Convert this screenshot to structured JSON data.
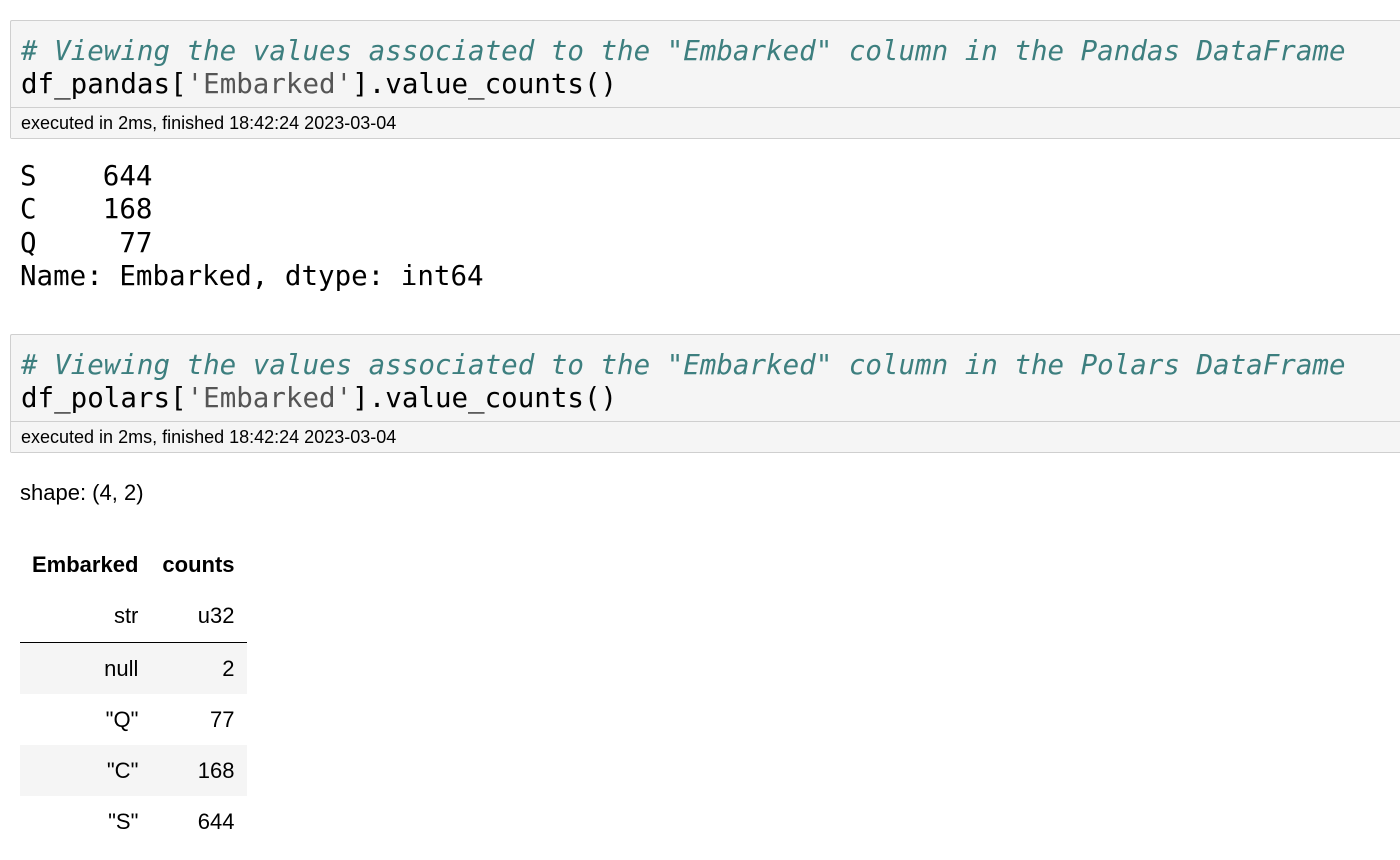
{
  "cell1": {
    "comment": "# Viewing the values associated to the \"Embarked\" column in the Pandas DataFrame",
    "code_prefix": "df_pandas[",
    "code_string": "'Embarked'",
    "code_suffix": "].value_counts()",
    "exec_info": "executed in 2ms, finished 18:42:24 2023-03-04",
    "output": "S    644\nC    168\nQ     77\nName: Embarked, dtype: int64"
  },
  "cell2": {
    "comment": "# Viewing the values associated to the \"Embarked\" column in the Polars DataFrame",
    "code_prefix": "df_polars[",
    "code_string": "'Embarked'",
    "code_suffix": "].value_counts()",
    "exec_info": "executed in 2ms, finished 18:42:24 2023-03-04",
    "shape": "shape: (4, 2)",
    "table": {
      "columns": [
        "Embarked",
        "counts"
      ],
      "dtypes": [
        "str",
        "u32"
      ],
      "rows": [
        [
          "null",
          "2"
        ],
        [
          "\"Q\"",
          "77"
        ],
        [
          "\"C\"",
          "168"
        ],
        [
          "\"S\"",
          "644"
        ]
      ]
    }
  }
}
